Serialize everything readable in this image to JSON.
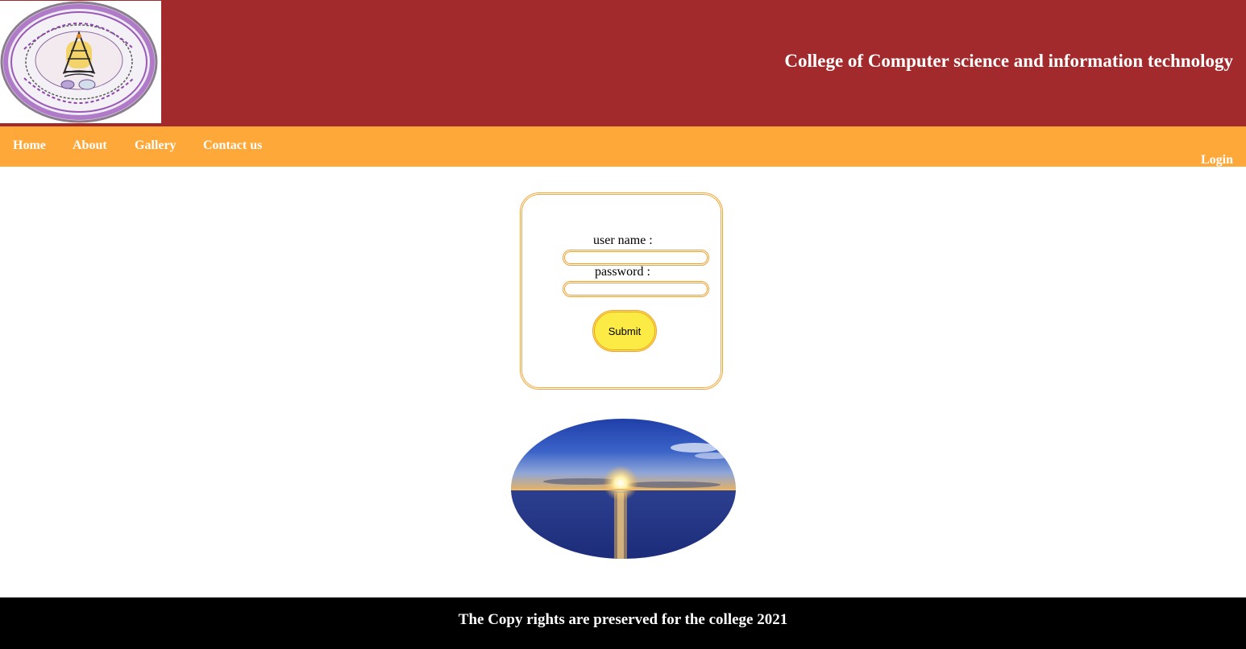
{
  "header": {
    "title": "College of Computer science and information technology",
    "logo_icon": "college-seal-logo"
  },
  "nav": {
    "items": [
      {
        "label": "Home"
      },
      {
        "label": "About"
      },
      {
        "label": "Gallery"
      },
      {
        "label": "Contact us"
      }
    ],
    "login_label": "Login"
  },
  "login_form": {
    "username_label": "user name :",
    "username_value": "",
    "password_label": "password :",
    "password_value": "",
    "submit_label": "Submit"
  },
  "image": {
    "icon": "ocean-sunset-image"
  },
  "footer": {
    "copyright": "The Copy rights are preserved for the college 2021"
  },
  "colors": {
    "header_bg": "#a32a2c",
    "nav_bg": "#ffa83a",
    "footer_bg": "#000000",
    "button_bg": "#fcea45",
    "border_accent": "#f0a030"
  }
}
